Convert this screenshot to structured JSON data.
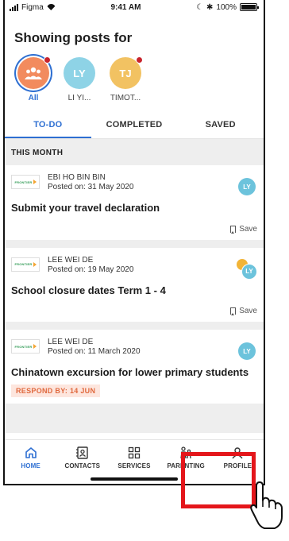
{
  "status_bar": {
    "carrier": "Figma",
    "time": "9:41 AM",
    "battery": "100%",
    "battery_level": 1.0
  },
  "header": {
    "title": "Showing posts for"
  },
  "people": [
    {
      "initials": "",
      "label": "All",
      "active": true,
      "color": "#f28b5e",
      "icon": "group-icon",
      "notification": true
    },
    {
      "initials": "LY",
      "label": "LI YI...",
      "active": false,
      "color": "#8ed3e6",
      "notification": false
    },
    {
      "initials": "TJ",
      "label": "TIMOT...",
      "active": false,
      "color": "#f2c262",
      "notification": true
    }
  ],
  "tabs": [
    {
      "label": "TO-DO",
      "active": true
    },
    {
      "label": "COMPLETED",
      "active": false
    },
    {
      "label": "SAVED",
      "active": false
    }
  ],
  "feed": {
    "section_title": "THIS MONTH",
    "posts": [
      {
        "logo_text": "FRONTIER",
        "author": "EBI HO BIN BIN",
        "date": "Posted on: 31 May 2020",
        "title": "Submit your travel declaration",
        "badge": "LY",
        "save_label": "Save"
      },
      {
        "logo_text": "FRONTIER",
        "author": "LEE WEI DE",
        "date": "Posted on: 19 May 2020",
        "title": "School closure dates Term 1 - 4",
        "badge": "LY",
        "save_label": "Save"
      },
      {
        "logo_text": "FRONTIER",
        "author": "LEE WEI DE",
        "date": "Posted on: 11 March 2020",
        "title": "Chinatown excursion for lower primary students",
        "badge": "LY",
        "respond": "RESPOND BY: 14 JUN"
      }
    ]
  },
  "nav": [
    {
      "label": "HOME",
      "icon": "home-icon",
      "active": true
    },
    {
      "label": "CONTACTS",
      "icon": "contacts-icon",
      "active": false
    },
    {
      "label": "SERVICES",
      "icon": "services-grid-icon",
      "active": false
    },
    {
      "label": "PARENTING",
      "icon": "parenting-icon",
      "active": false
    },
    {
      "label": "PROFILE",
      "icon": "profile-icon",
      "active": false
    }
  ],
  "colors": {
    "accent": "#2e6fd2",
    "highlight": "#e4161b",
    "respond_text": "#e0683d"
  }
}
